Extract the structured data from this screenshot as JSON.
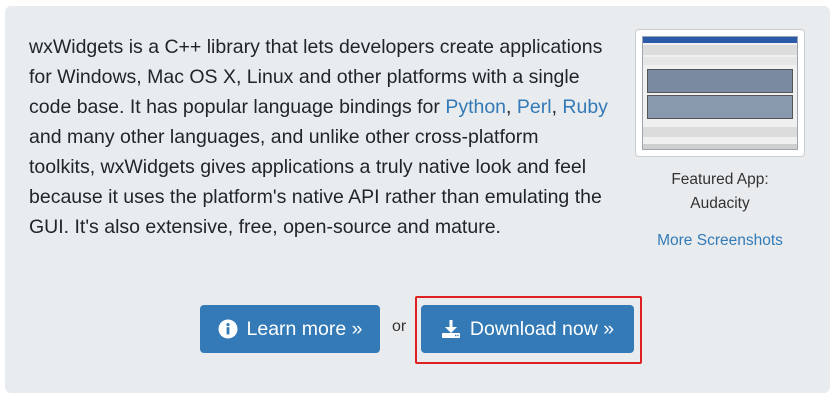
{
  "intro": {
    "text_before": "wxWidgets is a C++ library that lets developers create applications for Windows, Mac OS X, Linux and other platforms with a single code base. It has popular language bindings for ",
    "links": [
      "Python",
      "Perl",
      "Ruby"
    ],
    "sep_1": ", ",
    "sep_2": ", ",
    "text_after": " and many other languages, and unlike other cross-platform toolkits, wxWidgets gives applications a truly native look and feel because it uses the platform's native API rather than emulating the GUI. It's also extensive, free, open-source and mature."
  },
  "featured": {
    "caption_line1": "Featured App:",
    "caption_line2": "Audacity",
    "more_link": "More Screenshots"
  },
  "actions": {
    "learn_more": "Learn more »",
    "or_text": "or",
    "download_now": "Download now »"
  },
  "colors": {
    "panel_bg": "#e9ecef",
    "button_bg": "#337ab7",
    "link": "#337ab7",
    "highlight": "#e02020"
  },
  "icons": [
    "info-icon",
    "download-icon"
  ]
}
